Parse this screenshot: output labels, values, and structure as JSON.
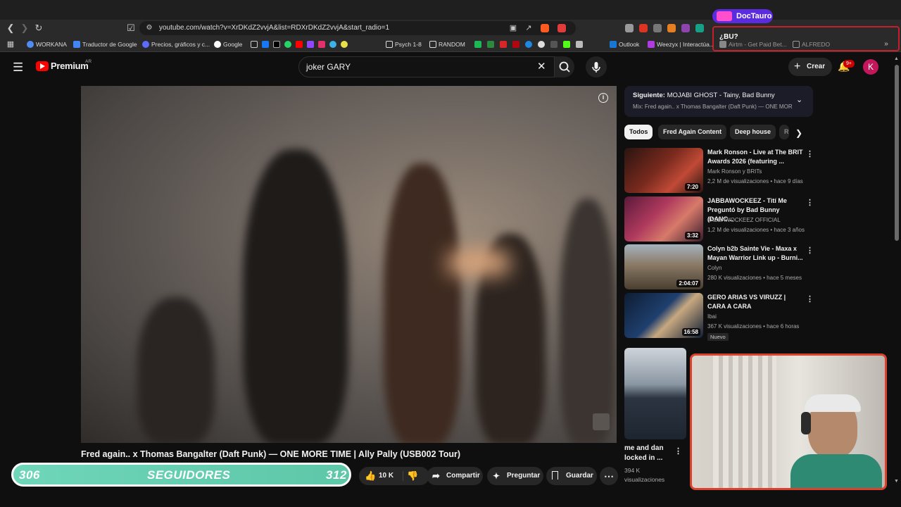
{
  "browser": {
    "url": "youtube.com/watch?v=XrDKdZ2vvjA&list=RDXrDKdZ2vvjA&start_radio=1",
    "bookmarks": [
      {
        "label": "WORKANA",
        "color": "#4f8df5"
      },
      {
        "label": "Traductor de Google",
        "color": "#4285f4"
      },
      {
        "label": "Precios, gráficos y c...",
        "color": "#5b6cff"
      },
      {
        "label": "Google",
        "color": "#ea4335"
      },
      {
        "label": "Psych 1-8",
        "color": "#e0c341"
      },
      {
        "label": "RANDOM",
        "color": "#e0c341"
      },
      {
        "label": "Outlook",
        "color": "#1976d2"
      },
      {
        "label": "Weezyx | Interactúa...",
        "color": "#b03be0"
      },
      {
        "label": "Airtm - Get Paid Bet...",
        "color": "#888888"
      },
      {
        "label": "ALFREDO",
        "color": "#e0c341"
      }
    ]
  },
  "overlay": {
    "badge_name": "DocTauro",
    "question": "¿BU?"
  },
  "header": {
    "logo_text": "Premium",
    "region": "AR",
    "search_value": "joker GARY",
    "create_label": "Crear",
    "notifications": "9+",
    "avatar_letter": "K"
  },
  "video": {
    "title": "Fred again.. x Thomas Bangalter (Daft Punk) — ONE MORE TIME | Ally Pally (USB002 Tour)",
    "likes": "10 K",
    "share_label": "Compartir",
    "ask_label": "Preguntar",
    "save_label": "Guardar"
  },
  "followers_widget": {
    "current": "306",
    "label": "SEGUIDORES",
    "goal": "312",
    "progress": 0.98
  },
  "up_next": {
    "label": "Siguiente:",
    "title": "MOJABI GHOST - Tainy, Bad Bunny",
    "mix": "Mix: Fred again.. x Thomas Bangalter (Daft Punk) — ONE MOR"
  },
  "chips": [
    "Todos",
    "Fred Again Content",
    "Deep house",
    "R"
  ],
  "related": [
    {
      "title": "Mark Ronson - Live at The BRIT Awards 2026 (featuring ...",
      "channel": "Mark Ronson y BRITs",
      "meta": "2,2 M de visualizaciones • hace 9 días",
      "duration": "7:20",
      "thumb_color": "#7a2a1e"
    },
    {
      "title": "JABBAWOCKEEZ - Tití Me Preguntó by Bad Bunny (DANC...",
      "channel": "JABBAWOCKEEZ OFFICIAL",
      "meta": "1,2 M de visualizaciones • hace 3 años",
      "duration": "3:32",
      "thumb_color": "#b03a5e"
    },
    {
      "title": "Colyn b2b Sainte Vie - Maxa x Mayan Warrior Link up - Burni...",
      "channel": "Colyn",
      "meta": "280 K visualizaciones • hace 5 meses",
      "duration": "2:04:07",
      "thumb_color": "#8a7a66"
    },
    {
      "title": "GERO ARIAS VS VIRUZZ | CARA A CARA",
      "channel": "Ibai",
      "meta": "367 K visualizaciones • hace 6 horas",
      "duration": "16:58",
      "thumb_color": "#1f3f6e",
      "badge": "Nuevo"
    }
  ],
  "partial_video": {
    "title": "me and dan locked in ...",
    "views": "394 K",
    "meta": "visualizaciones"
  }
}
